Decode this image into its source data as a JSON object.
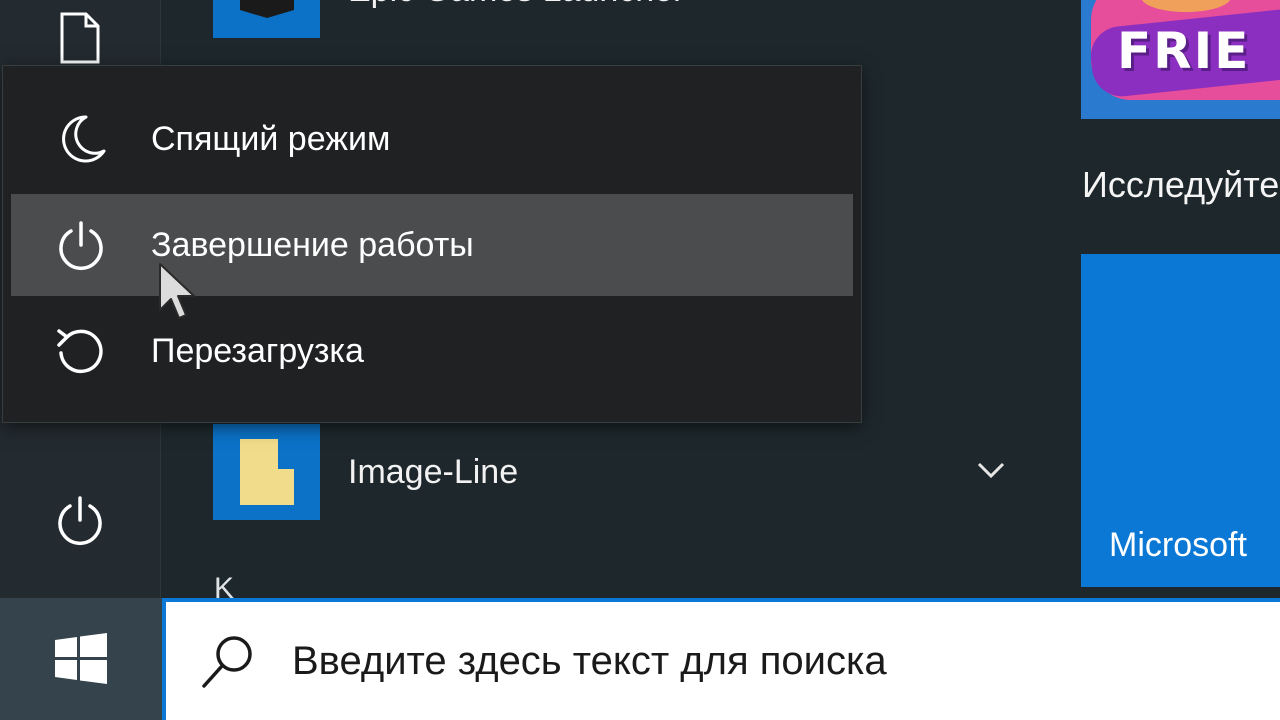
{
  "power_menu": {
    "items": [
      {
        "label": "Спящий режим",
        "icon": "moon-icon"
      },
      {
        "label": "Завершение работы",
        "icon": "power-icon",
        "hovered": true
      },
      {
        "label": "Перезагрузка",
        "icon": "restart-icon"
      }
    ]
  },
  "app_list": {
    "top_app": "Epic Games Launcher",
    "items": [
      {
        "label": "Image-Line",
        "icon": "folder-icon",
        "expandable": true
      }
    ],
    "section_letter": "K"
  },
  "tiles": {
    "top_tile_text": "FRIE",
    "section_header": "Исследуйте",
    "microsoft_tile_label": "Microsoft"
  },
  "left_rail": {
    "items": [
      "document-icon",
      "power-icon"
    ]
  },
  "taskbar": {
    "start_icon": "windows-logo-icon",
    "search_placeholder": "Введите здесь текст для поиска"
  },
  "colors": {
    "accent": "#0a78d4",
    "menu_bg": "#1f2123",
    "hover_bg": "#4a4c4e"
  }
}
